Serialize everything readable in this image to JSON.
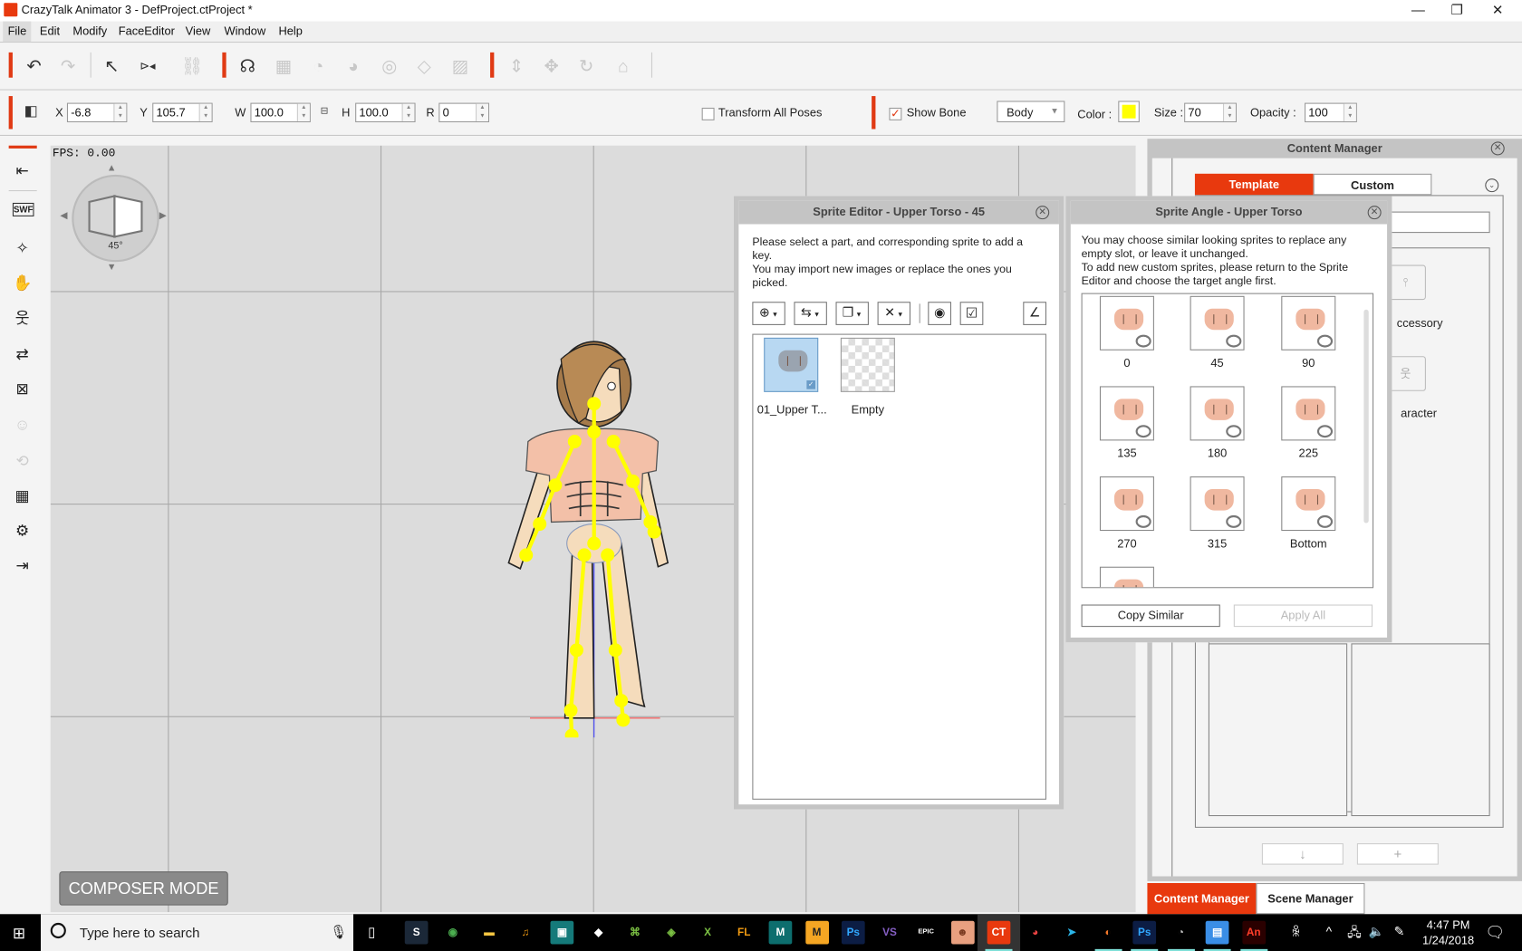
{
  "window": {
    "title": "CrazyTalk Animator 3   - DefProject.ctProject *",
    "controls": {
      "minimize": "—",
      "restore": "❐",
      "close": "✕"
    }
  },
  "menu": {
    "items": [
      {
        "label": "File",
        "accel": "F"
      },
      {
        "label": "Edit",
        "accel": "E"
      },
      {
        "label": "Modify",
        "accel": "M"
      },
      {
        "label": "FaceEditor",
        "accel": "F"
      },
      {
        "label": "View",
        "accel": "V"
      },
      {
        "label": "Window",
        "accel": "W"
      },
      {
        "label": "Help",
        "accel": "H"
      }
    ]
  },
  "toolbar": {
    "icons": [
      {
        "name": "undo-icon",
        "glyph": "↶",
        "enabled": true
      },
      {
        "name": "redo-icon",
        "glyph": "↷",
        "enabled": false
      },
      {
        "name": "select-arrow-icon",
        "glyph": "↖",
        "enabled": true
      },
      {
        "name": "flip-icon",
        "glyph": "⊳◂",
        "enabled": true
      },
      {
        "name": "link-icon",
        "glyph": "⛓",
        "enabled": false
      },
      {
        "name": "face-key-icon",
        "glyph": "☊",
        "enabled": true
      },
      {
        "name": "face-puppet-icon",
        "glyph": "▦",
        "enabled": false
      },
      {
        "name": "head-profile-icon",
        "glyph": "◔",
        "enabled": false
      },
      {
        "name": "head-grid-icon",
        "glyph": "◕",
        "enabled": false
      },
      {
        "name": "eye-icon",
        "glyph": "◎",
        "enabled": false
      },
      {
        "name": "lips-icon",
        "glyph": "◇",
        "enabled": false
      },
      {
        "name": "face-mask-icon",
        "glyph": "▨",
        "enabled": false
      },
      {
        "name": "move-vertical-icon",
        "glyph": "⇕",
        "enabled": false
      },
      {
        "name": "move-icon",
        "glyph": "✥",
        "enabled": false
      },
      {
        "name": "rotate-icon",
        "glyph": "↻",
        "enabled": false
      },
      {
        "name": "home-icon",
        "glyph": "⌂",
        "enabled": false
      }
    ]
  },
  "transform": {
    "x_label": "X",
    "x_value": "-6.8",
    "y_label": "Y",
    "y_value": "105.7",
    "w_label": "W",
    "w_value": "100.0",
    "h_label": "H",
    "h_value": "100.0",
    "r_label": "R",
    "r_value": "0",
    "transform_all_poses": {
      "label": "Transform All Poses",
      "checked": false
    },
    "show_bone": {
      "label": "Show Bone",
      "checked": true
    },
    "bone_select": "Body",
    "color_label": "Color :",
    "color_value": "#ffff00",
    "size_label": "Size :",
    "size_value": "70",
    "opacity_label": "Opacity :",
    "opacity_value": "100"
  },
  "left_tools": [
    {
      "name": "stage-back-icon",
      "glyph": "⇤",
      "enabled": true
    },
    {
      "name": "export-swf-icon",
      "glyph": "SWF",
      "enabled": true
    },
    {
      "name": "magic-wand-icon",
      "glyph": "✧",
      "enabled": true
    },
    {
      "name": "hand-gesture-icon",
      "glyph": "✋",
      "enabled": false
    },
    {
      "name": "body-scale-icon",
      "glyph": "웃",
      "enabled": true
    },
    {
      "name": "body-mirror-icon",
      "glyph": "⇄",
      "enabled": true
    },
    {
      "name": "mask-pattern-icon",
      "glyph": "⊠",
      "enabled": true
    },
    {
      "name": "head-grid-icon",
      "glyph": "☺",
      "enabled": false
    },
    {
      "name": "rotate-sprite-icon",
      "glyph": "⟲",
      "enabled": false
    },
    {
      "name": "sprite-grid-icon",
      "glyph": "▦",
      "enabled": true
    },
    {
      "name": "sprite-settings-icon",
      "glyph": "⚙",
      "enabled": true
    },
    {
      "name": "import-icon",
      "glyph": "⇥",
      "enabled": true
    }
  ],
  "stage": {
    "fps": "FPS:  0.00",
    "angle": "45°",
    "composer_mode": "COMPOSER MODE"
  },
  "sprite_editor": {
    "title": "Sprite Editor - Upper Torso - 45",
    "instructions": [
      "Please select a part, and corresponding sprite to add a key.",
      "You may import new images or replace the ones you picked."
    ],
    "tools": [
      {
        "name": "add-sprite-icon",
        "glyph": "⊕"
      },
      {
        "name": "replace-sprite-icon",
        "glyph": "⇆"
      },
      {
        "name": "duplicate-sprite-icon",
        "glyph": "❐"
      },
      {
        "name": "delete-sprite-icon",
        "glyph": "✕"
      },
      {
        "name": "preview-eye-icon",
        "glyph": "◉"
      },
      {
        "name": "checkbox-icon",
        "glyph": "☑"
      },
      {
        "name": "angle-settings-icon",
        "glyph": "∠"
      }
    ],
    "sprites": [
      {
        "label": "01_Upper T...",
        "selected": true
      },
      {
        "label": "Empty",
        "selected": false
      }
    ]
  },
  "sprite_angle": {
    "title": "Sprite Angle - Upper Torso",
    "instructions": [
      "You may choose similar looking sprites to replace any empty slot, or leave it unchanged.",
      "To add new custom sprites, please return to the Sprite Editor and choose the target angle first."
    ],
    "angles": [
      "0",
      "45",
      "90",
      "135",
      "180",
      "225",
      "270",
      "315",
      "Bottom"
    ],
    "copy_similar": "Copy Similar",
    "apply_all": "Apply All"
  },
  "content_manager": {
    "title": "Content Manager",
    "tabs": [
      {
        "label": "Template",
        "active": true
      },
      {
        "label": "Custom",
        "active": false
      }
    ],
    "folders": [
      "ccessory",
      "aracter"
    ],
    "bottom_tabs": [
      {
        "label": "Content Manager",
        "active": true
      },
      {
        "label": "Scene Manager",
        "active": false
      }
    ]
  },
  "taskbar": {
    "search_placeholder": "Type here to search",
    "apps": [
      {
        "name": "steam-icon",
        "label": "S",
        "bg": "#1b2838",
        "fg": "#fff",
        "running": false
      },
      {
        "name": "chrome-icon",
        "label": "◉",
        "bg": "#000",
        "fg": "#4caf50",
        "running": false
      },
      {
        "name": "file-explorer-icon",
        "label": "▬",
        "bg": "#000",
        "fg": "#f4c542",
        "running": false
      },
      {
        "name": "audio-app-icon",
        "label": "♫",
        "bg": "#000",
        "fg": "#f39c12",
        "running": false
      },
      {
        "name": "screen-app-icon",
        "label": "▣",
        "bg": "#157a7a",
        "fg": "#fff",
        "running": false
      },
      {
        "name": "unity-icon",
        "label": "◆",
        "bg": "#000",
        "fg": "#fff",
        "running": false
      },
      {
        "name": "gamepad-app-icon",
        "label": "⌘",
        "bg": "#000",
        "fg": "#7bc043",
        "running": false
      },
      {
        "name": "target-app-icon",
        "label": "◈",
        "bg": "#000",
        "fg": "#7bc043",
        "running": false
      },
      {
        "name": "xsplit-icon",
        "label": "X",
        "bg": "#000",
        "fg": "#7bc043",
        "running": false
      },
      {
        "name": "fl-studio-icon",
        "label": "FL",
        "bg": "#000",
        "fg": "#f39c12",
        "running": false
      },
      {
        "name": "maya-icon",
        "label": "M",
        "bg": "#0d6e6e",
        "fg": "#fff",
        "running": false
      },
      {
        "name": "m-app-icon",
        "label": "M",
        "bg": "#f5a623",
        "fg": "#222",
        "running": false
      },
      {
        "name": "photoshop-icon",
        "label": "Ps",
        "bg": "#0c1d44",
        "fg": "#31a8ff",
        "running": false
      },
      {
        "name": "visual-studio-icon",
        "label": "VS",
        "bg": "#000",
        "fg": "#865fc5",
        "running": false
      },
      {
        "name": "epic-games-icon",
        "label": "EPIC",
        "bg": "#000",
        "fg": "#fff",
        "running": false
      },
      {
        "name": "face-app-icon",
        "label": "☻",
        "bg": "#e8a080",
        "fg": "#7a3a20",
        "running": false
      },
      {
        "name": "crazytalk-icon",
        "label": "CT",
        "bg": "#e8390e",
        "fg": "#fff",
        "running": true
      },
      {
        "name": "davinci-icon",
        "label": "◕",
        "bg": "#000",
        "fg": "#e44",
        "running": false
      },
      {
        "name": "arrow-app-icon",
        "label": "➤",
        "bg": "#000",
        "fg": "#2bb5e8",
        "running": false
      },
      {
        "name": "blender-icon",
        "label": "◐",
        "bg": "#000",
        "fg": "#f5792a",
        "running": true
      },
      {
        "name": "photoshop-2-icon",
        "label": "Ps",
        "bg": "#0c1d44",
        "fg": "#31a8ff",
        "running": true
      },
      {
        "name": "speaker-app-icon",
        "label": "◔",
        "bg": "#000",
        "fg": "#ccc",
        "running": true
      },
      {
        "name": "dashboard-app-icon",
        "label": "▤",
        "bg": "#3a8ee6",
        "fg": "#fff",
        "running": true
      },
      {
        "name": "animate-icon",
        "label": "An",
        "bg": "#2a0000",
        "fg": "#ff3e2a",
        "running": true
      }
    ],
    "time": "4:47 PM",
    "date": "1/24/2018"
  }
}
